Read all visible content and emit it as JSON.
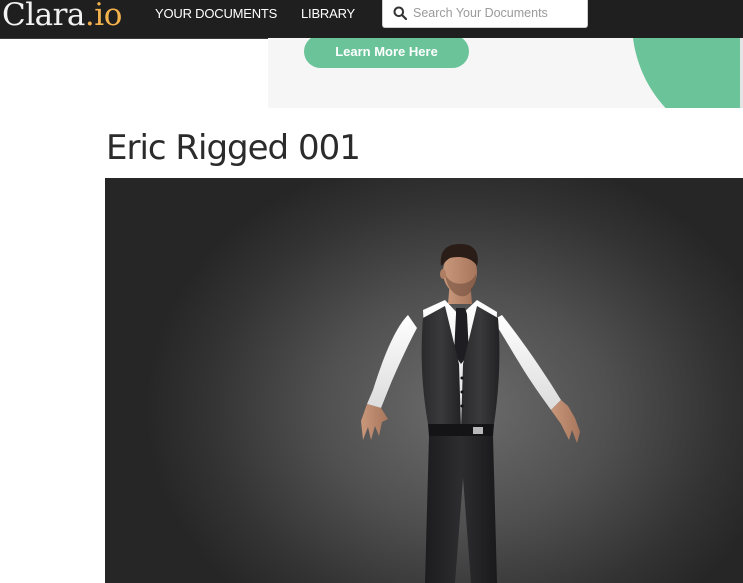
{
  "header": {
    "logo_main": "Clara",
    "logo_ext": ".io",
    "nav": [
      {
        "label": "YOUR DOCUMENTS"
      },
      {
        "label": "LIBRARY"
      }
    ],
    "search": {
      "placeholder": "Search Your Documents",
      "value": "",
      "icon": "search-icon"
    }
  },
  "banner": {
    "button_label": "Learn More Here",
    "accent_color": "#6bc39a"
  },
  "document": {
    "title": "Eric Rigged 001"
  },
  "viewer": {
    "model_name": "Eric Rigged 001",
    "background": "#4a4a4a"
  }
}
